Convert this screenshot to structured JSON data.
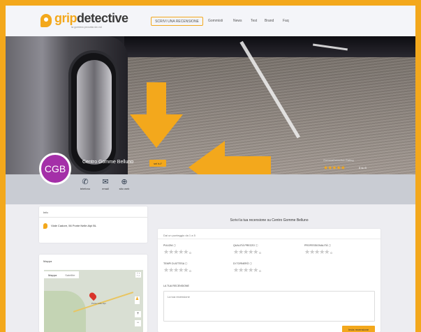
{
  "header": {
    "logo_accent": "grip",
    "logo_main": "detective",
    "logo_tagline": "la gomma provata da voi",
    "cta_label": "SCRIVI UNA RECENSIONE",
    "nav": [
      "Gommisti",
      "News",
      "Test",
      "Brand",
      "Faq"
    ]
  },
  "profile": {
    "initials": "CGB",
    "name": "Centro Gomme Belluno",
    "claim_label": "sei tu?",
    "rating_title": "GommaDetective Rating",
    "rating_stars": "★★★★★",
    "rating_value": "5 su 5"
  },
  "contact": [
    {
      "icon": "phone-icon",
      "glyph": "✆",
      "label": "telefono"
    },
    {
      "icon": "email-icon",
      "glyph": "✉",
      "label": "email"
    },
    {
      "icon": "globe-icon",
      "glyph": "⊕",
      "label": "sito web"
    }
  ],
  "info": {
    "heading": "Info",
    "address": "Viale Cadore, 56 Ponte Nelle Alpi BL"
  },
  "map": {
    "heading": "Mappa",
    "tabs": [
      "Mappa",
      "Satellite"
    ],
    "town_label": "Ponte nelle Alpi"
  },
  "review": {
    "title": "Scrivi la tua recensione su Centro Gomme Belluno",
    "help": "Dai un punteggio da 1 a 5",
    "criteria": [
      {
        "label": "PULIZIA ⓘ",
        "stars": "★★★★★",
        "score": "0"
      },
      {
        "label": "QUALITÀ PREZZO ⓘ",
        "stars": "★★★★★",
        "score": "0"
      },
      {
        "label": "PROFESSIONALITÀ ⓘ",
        "stars": "★★★★★",
        "score": "0"
      },
      {
        "label": "TEMPI DI ATTESA ⓘ",
        "stars": "★★★★★",
        "score": "0"
      },
      {
        "label": "DI TORNERÒ ⓘ",
        "stars": "★★★★★",
        "score": "0"
      }
    ],
    "text_label": "LA TUA RECENSIONE",
    "text_placeholder": "La tua recensione",
    "submit_label": "Invia recensione"
  },
  "colors": {
    "accent": "#f3a81c",
    "avatar": "#a42fa8",
    "contact_strip": "#c9ccd3"
  }
}
